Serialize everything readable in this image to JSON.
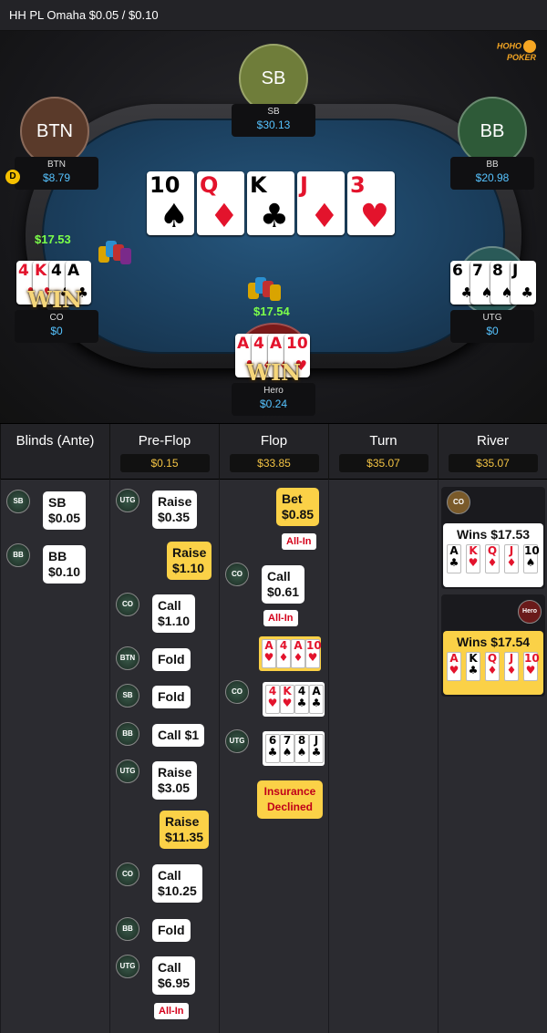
{
  "title": "HH PL Omaha $0.05 / $0.10",
  "logo": {
    "line1": "HOHO",
    "line2": "POKER"
  },
  "seats": {
    "sb": {
      "avatar": "SB",
      "name": "SB",
      "stack": "$30.13"
    },
    "btn": {
      "avatar": "BTN",
      "name": "BTN",
      "stack": "$8.79"
    },
    "bb": {
      "avatar": "BB",
      "name": "BB",
      "stack": "$20.98"
    },
    "co": {
      "name": "CO",
      "stack": "$0",
      "bet": "$17.53"
    },
    "utg": {
      "name": "UTG",
      "stack": "$0"
    },
    "hero": {
      "name": "Hero",
      "stack": "$0.24",
      "bet": "$17.54"
    }
  },
  "dealer_label": "D",
  "win_label": "WIN",
  "board": [
    {
      "r": "10",
      "s": "♠",
      "c": "blk"
    },
    {
      "r": "Q",
      "s": "♦",
      "c": "red"
    },
    {
      "r": "K",
      "s": "♣",
      "c": "blk"
    },
    {
      "r": "J",
      "s": "♦",
      "c": "red"
    },
    {
      "r": "3",
      "s": "♥",
      "c": "red"
    }
  ],
  "co_hand": [
    {
      "r": "4",
      "s": "♥",
      "c": "red"
    },
    {
      "r": "K",
      "s": "♥",
      "c": "red"
    },
    {
      "r": "4",
      "s": "♣",
      "c": "blk"
    },
    {
      "r": "A",
      "s": "♣",
      "c": "blk"
    }
  ],
  "utg_hand": [
    {
      "r": "6",
      "s": "♣",
      "c": "blk"
    },
    {
      "r": "7",
      "s": "♠",
      "c": "blk"
    },
    {
      "r": "8",
      "s": "♠",
      "c": "blk"
    },
    {
      "r": "J",
      "s": "♣",
      "c": "blk"
    }
  ],
  "hero_hand": [
    {
      "r": "A",
      "s": "♥",
      "c": "red"
    },
    {
      "r": "4",
      "s": "♦",
      "c": "red"
    },
    {
      "r": "A",
      "s": "♦",
      "c": "red"
    },
    {
      "r": "10",
      "s": "♥",
      "c": "red"
    }
  ],
  "streets": [
    {
      "name": "Blinds (Ante)",
      "pot": ""
    },
    {
      "name": "Pre-Flop",
      "pot": "$0.15"
    },
    {
      "name": "Flop",
      "pot": "$33.85"
    },
    {
      "name": "Turn",
      "pot": "$35.07"
    },
    {
      "name": "River",
      "pot": "$35.07"
    }
  ],
  "blinds": [
    {
      "pos": "SB",
      "l1": "SB",
      "l2": "$0.05"
    },
    {
      "pos": "BB",
      "l1": "BB",
      "l2": "$0.10"
    }
  ],
  "preflop": [
    {
      "pos": "UTG",
      "l1": "Raise",
      "l2": "$0.35"
    },
    {
      "pos": "",
      "l1": "Raise",
      "l2": "$1.10"
    },
    {
      "pos": "CO",
      "l1": "Call",
      "l2": "$1.10"
    },
    {
      "pos": "BTN",
      "l1": "Fold"
    },
    {
      "pos": "SB",
      "l1": "Fold"
    },
    {
      "pos": "BB",
      "l1": "Call  $1"
    },
    {
      "pos": "UTG",
      "l1": "Raise",
      "l2": "$3.05"
    },
    {
      "pos": "",
      "l1": "Raise",
      "l2": "$11.35"
    },
    {
      "pos": "CO",
      "l1": "Call",
      "l2": "$10.25"
    },
    {
      "pos": "BB",
      "l1": "Fold"
    },
    {
      "pos": "UTG",
      "l1": "Call",
      "l2": "$6.95"
    }
  ],
  "allin": "All-In",
  "flop": {
    "bet_l1": "Bet",
    "bet_l2": "$0.85",
    "call_pos": "CO",
    "call_l1": "Call",
    "call_l2": "$0.61",
    "co_pos": "CO",
    "utg_pos": "UTG",
    "insurance": "Insurance Declined"
  },
  "river": {
    "co_pos": "CO",
    "co_win": "Wins $17.53",
    "hero_pos": "Hero",
    "hero_win": "Wins $17.54",
    "co_cards": [
      {
        "r": "A",
        "s": "♣",
        "c": "blk"
      },
      {
        "r": "K",
        "s": "♥",
        "c": "red"
      },
      {
        "r": "Q",
        "s": "♦",
        "c": "red"
      },
      {
        "r": "J",
        "s": "♦",
        "c": "red"
      },
      {
        "r": "10",
        "s": "♠",
        "c": "blk"
      }
    ],
    "hero_cards": [
      {
        "r": "A",
        "s": "♥",
        "c": "red"
      },
      {
        "r": "K",
        "s": "♣",
        "c": "blk"
      },
      {
        "r": "Q",
        "s": "♦",
        "c": "red"
      },
      {
        "r": "J",
        "s": "♦",
        "c": "red"
      },
      {
        "r": "10",
        "s": "♥",
        "c": "red"
      }
    ]
  }
}
